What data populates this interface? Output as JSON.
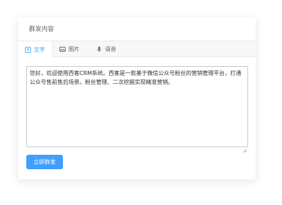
{
  "card": {
    "title": "群发内容"
  },
  "tabs": [
    {
      "label": "文字",
      "icon": "text-icon",
      "active": true
    },
    {
      "label": "图片",
      "icon": "image-icon",
      "active": false
    },
    {
      "label": "语音",
      "icon": "microphone-icon",
      "active": false
    }
  ],
  "editor": {
    "value": "您好，欢迎使用西客CRM系统。西客是一款基于微信公众号粉丝的营销管理平台，打通公众号售前售后场景。粉丝管理、二次挖掘实现精准营销。"
  },
  "actions": {
    "send_label": "立即群发"
  },
  "colors": {
    "accent": "#409eff",
    "tab_bar": "#f6f7f9"
  }
}
